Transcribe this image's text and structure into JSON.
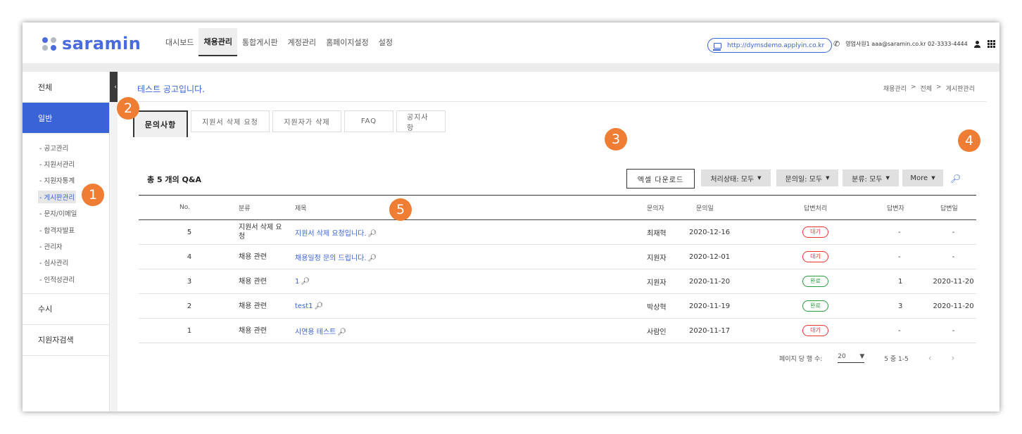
{
  "logo": {
    "text": "saramin",
    "dot_colors": [
      "#4a6ae0",
      "#b7bac4",
      "#b7bac4",
      "#4a6ae0"
    ]
  },
  "topnav": {
    "items": [
      {
        "label": "대시보드",
        "active": false
      },
      {
        "label": "채용관리",
        "active": true
      },
      {
        "label": "통합게시판",
        "active": false
      },
      {
        "label": "계정관리",
        "active": false
      },
      {
        "label": "홈페이지설정",
        "active": false
      },
      {
        "label": "설정",
        "active": false
      }
    ]
  },
  "header": {
    "url": "http://dymsdemo.applyin.co.kr",
    "user": "영업사원1 aaa@saramin.co.kr 02-3333-4444",
    "icons": [
      "monitor-icon",
      "phone-icon",
      "person-icon",
      "apps-grid-icon"
    ]
  },
  "sidebar": {
    "sections": {
      "all": "전체",
      "general": "일반",
      "rolling": "수시",
      "applicant_search": "지원자검색"
    },
    "items": [
      {
        "label": "- 공고관리"
      },
      {
        "label": "- 지원서관리"
      },
      {
        "label": "- 지원자통계"
      },
      {
        "label": "- 게시판관리",
        "current": true
      },
      {
        "label": "- 문자/이메일"
      },
      {
        "label": "- 합격자발표"
      },
      {
        "label": "- 관리자"
      },
      {
        "label": "- 심사관리"
      },
      {
        "label": "- 인적성관리"
      }
    ],
    "collapse_icon": "chevron-left-icon"
  },
  "page": {
    "title": "테스트 공고입니다.",
    "breadcrumb": [
      "채용관리",
      ">",
      "전체",
      ">",
      "게시판관리"
    ]
  },
  "tabs": [
    {
      "label": "문의사항",
      "active": true
    },
    {
      "label": "지원서 삭제 요청"
    },
    {
      "label": "지원자가 삭제"
    },
    {
      "label": "FAQ"
    },
    {
      "label": "공지사항"
    }
  ],
  "toolbar": {
    "count_label": "총 5 개의 Q&A",
    "excel_label": "엑셀 다운로드",
    "filters": [
      {
        "label": "처리상태: 모두"
      },
      {
        "label": "문의일: 모두"
      },
      {
        "label": "분류: 모두"
      },
      {
        "label": "More"
      }
    ],
    "search_icon": "search-icon"
  },
  "table": {
    "headers": [
      "No.",
      "분류",
      "제목",
      "문의자",
      "문의일",
      "답변처리",
      "답변자",
      "답변일"
    ],
    "rows": [
      {
        "no": "5",
        "category": "지원서 삭제 요청",
        "title": "지원서 삭제 요청입니다.",
        "inquirer": "최재혁",
        "date": "2020-12-16",
        "status": "대기",
        "status_type": "wait",
        "responder": "-",
        "answer_date": "-"
      },
      {
        "no": "4",
        "category": "채용 관련",
        "title": "채용일정 문의 드립니다.",
        "inquirer": "지원자",
        "date": "2020-12-01",
        "status": "대기",
        "status_type": "wait",
        "responder": "-",
        "answer_date": "-"
      },
      {
        "no": "3",
        "category": "채용 관련",
        "title": "1",
        "inquirer": "지원자",
        "date": "2020-11-20",
        "status": "완료",
        "status_type": "done",
        "responder": "1",
        "answer_date": "2020-11-20"
      },
      {
        "no": "2",
        "category": "채용 관련",
        "title": "test1",
        "inquirer": "박상혁",
        "date": "2020-11-19",
        "status": "완료",
        "status_type": "done",
        "responder": "3",
        "answer_date": "2020-11-20"
      },
      {
        "no": "1",
        "category": "채용 관련",
        "title": "시연용 테스트",
        "inquirer": "사람인",
        "date": "2020-11-17",
        "status": "대기",
        "status_type": "wait",
        "responder": "-",
        "answer_date": "-"
      }
    ]
  },
  "pagination": {
    "rows_per_page_label": "페이지 당 행 수:",
    "rows_per_page": "20",
    "range": "5 중 1-5",
    "prev_icon": "chevron-left-icon",
    "next_icon": "chevron-right-icon"
  },
  "markers": [
    "1",
    "2",
    "3",
    "4",
    "5"
  ],
  "colors": {
    "accent": "#3a63d8",
    "marker": "#f07d34",
    "wait": "#e33333",
    "done": "#2a9b3f"
  }
}
